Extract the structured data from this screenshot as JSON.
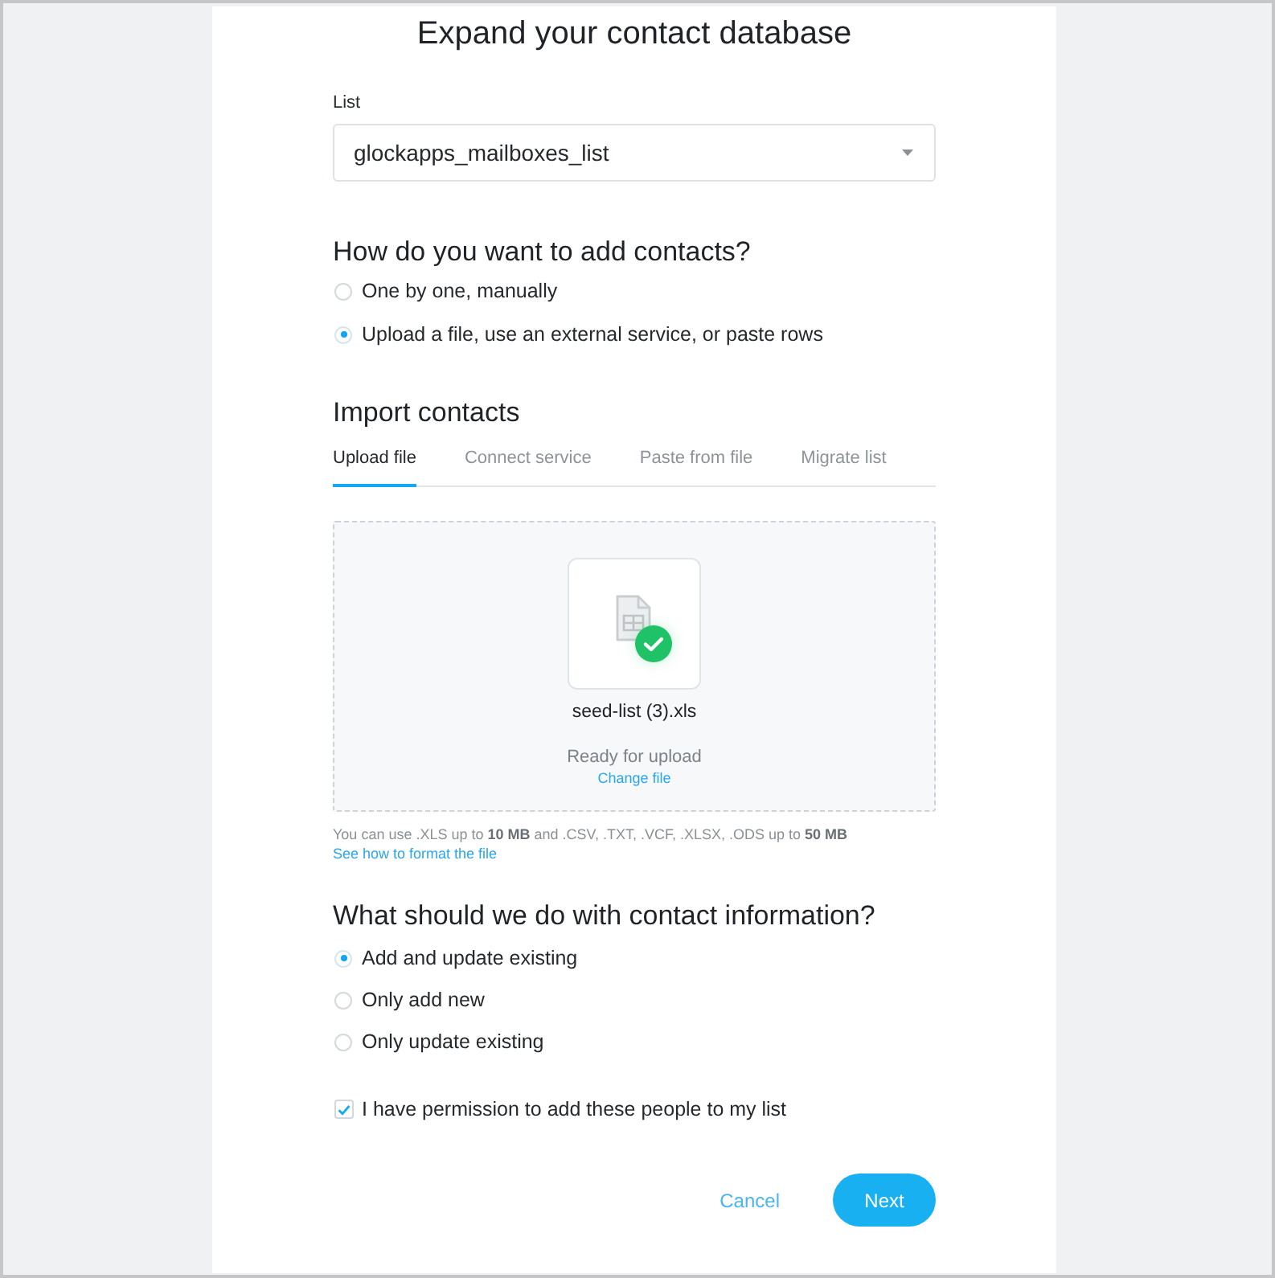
{
  "title": "Expand your contact database",
  "list_field": {
    "label": "List",
    "value": "glockapps_mailboxes_list"
  },
  "add_method": {
    "heading": "How do you want to add contacts?",
    "options": [
      {
        "label": "One by one, manually",
        "selected": false
      },
      {
        "label": "Upload a file, use an external service, or paste rows",
        "selected": true
      }
    ]
  },
  "import": {
    "heading": "Import contacts",
    "tabs": [
      {
        "label": "Upload file",
        "selected": true
      },
      {
        "label": "Connect service",
        "selected": false
      },
      {
        "label": "Paste from file",
        "selected": false
      },
      {
        "label": "Migrate list",
        "selected": false
      }
    ],
    "file": {
      "name": "seed-list (3).xls",
      "status": "Ready for upload",
      "change_link": "Change file"
    },
    "hint": "You can use .XLS up to **10 MB** and .CSV, .TXT, .VCF, .XLSX, .ODS up to **50 MB**",
    "format_link": "See how to format the file"
  },
  "contact_info": {
    "heading": "What should we do with contact information?",
    "options": [
      {
        "label": "Add and update existing",
        "selected": true
      },
      {
        "label": "Only add new",
        "selected": false
      },
      {
        "label": "Only update existing",
        "selected": false
      }
    ]
  },
  "permission": {
    "label": "I have permission to add these people to my list",
    "checked": true
  },
  "buttons": [
    {
      "label": "Cancel",
      "kind": "text"
    },
    {
      "label": "Next",
      "kind": "primary"
    }
  ]
}
